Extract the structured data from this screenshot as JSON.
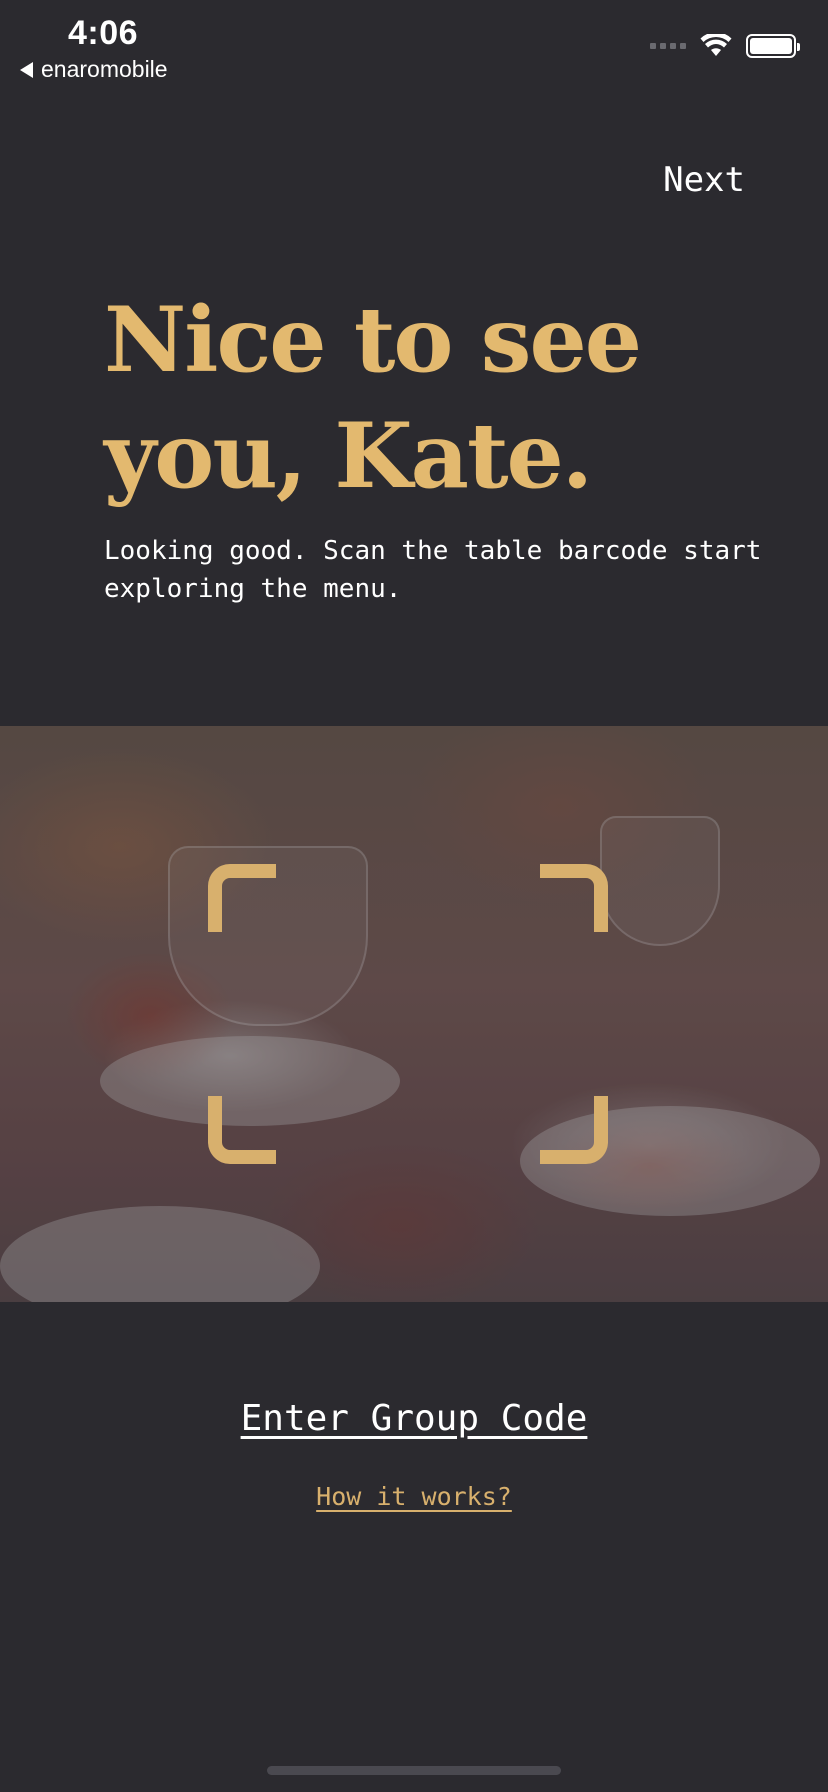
{
  "status_bar": {
    "time": "4:06",
    "back_app": "enaromobile"
  },
  "header": {
    "next_label": "Next"
  },
  "welcome": {
    "title": "Nice to see you, Kate.",
    "subtitle": "Looking good. Scan the table barcode start exploring the menu."
  },
  "actions": {
    "group_code_label": "Enter Group Code",
    "how_it_works_label": "How it works?"
  },
  "colors": {
    "background": "#2b2a2f",
    "accent": "#e3b96f",
    "text": "#ffffff"
  },
  "icons": {
    "back": "back-caret-icon",
    "signal": "cellular-signal-icon",
    "wifi": "wifi-icon",
    "battery": "battery-icon",
    "scanner": "scan-frame-icon"
  }
}
